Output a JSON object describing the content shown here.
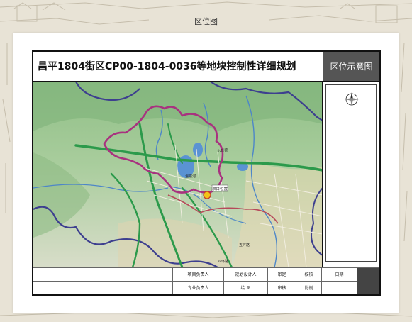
{
  "page": {
    "caption": "区位图"
  },
  "sheet": {
    "title": "昌平1804街区CP00-1804-0036等地块控制性详细规划",
    "side_label": "区位示意图",
    "compass_icon": "north-arrow-icon"
  },
  "map": {
    "labels": {
      "project_location": "项目位置",
      "road_1": "六环路",
      "river": "温榆河",
      "road_2": "五环路",
      "road_3": "四环路"
    },
    "colors": {
      "district_boundary": "#a8327f",
      "major_road": "#2c9a4b",
      "region_boundary": "#3d3f8f",
      "water": "#4d86c8",
      "project_marker": "#f3c318"
    }
  },
  "title_block": {
    "project_leader": "项目负责人",
    "planner": "规划设计人",
    "review": "审定",
    "check": "校核",
    "drawing_no": "日期",
    "professional_leader": "专业负责人",
    "drawer": "绘  图",
    "audit": "审核",
    "scale": "比例"
  }
}
